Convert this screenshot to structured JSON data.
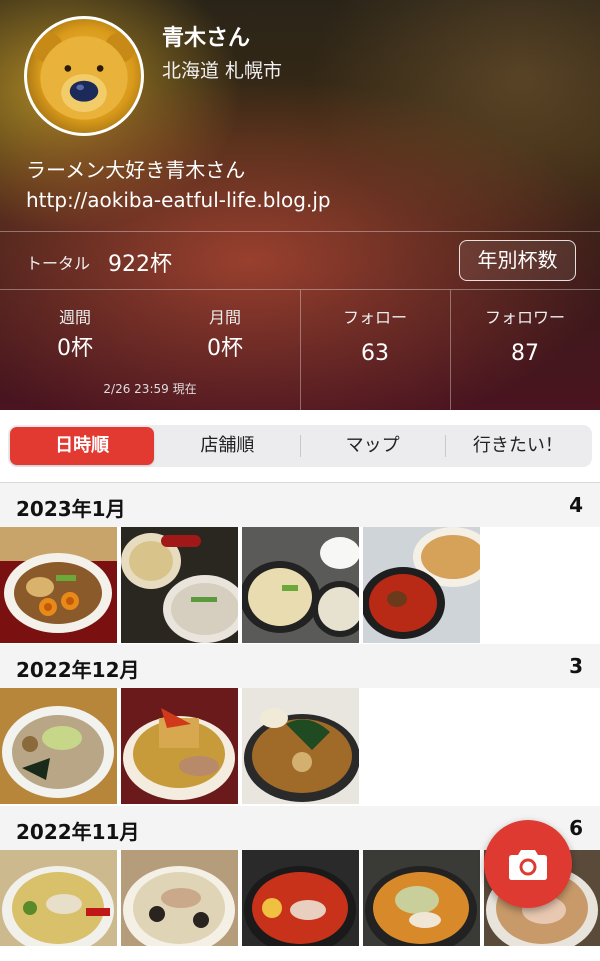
{
  "profile": {
    "name": "青木さん",
    "location": "北海道 札幌市",
    "bio": "ラーメン大好き青木さん",
    "url": "http://aokiba-eatful-life.blog.jp",
    "avatar_icon": "bear-avatar-photo"
  },
  "totals": {
    "label": "トータル",
    "value": "922杯",
    "yearly_button": "年別杯数"
  },
  "stats": {
    "weekly_label": "週間",
    "weekly_value": "0杯",
    "monthly_label": "月間",
    "monthly_value": "0杯",
    "follow_label": "フォロー",
    "follow_value": "63",
    "follower_label": "フォロワー",
    "follower_value": "87",
    "as_of": "2/26 23:59 現在"
  },
  "tabs": [
    "日時順",
    "店舗順",
    "マップ",
    "行きたい！"
  ],
  "active_tab": 0,
  "months": [
    {
      "title": "2023年1月",
      "count": "4"
    },
    {
      "title": "2022年12月",
      "count": "3"
    },
    {
      "title": "2022年11月",
      "count": "6"
    }
  ],
  "colors": {
    "accent": "#e23a31"
  },
  "fab_icon": "camera-icon"
}
